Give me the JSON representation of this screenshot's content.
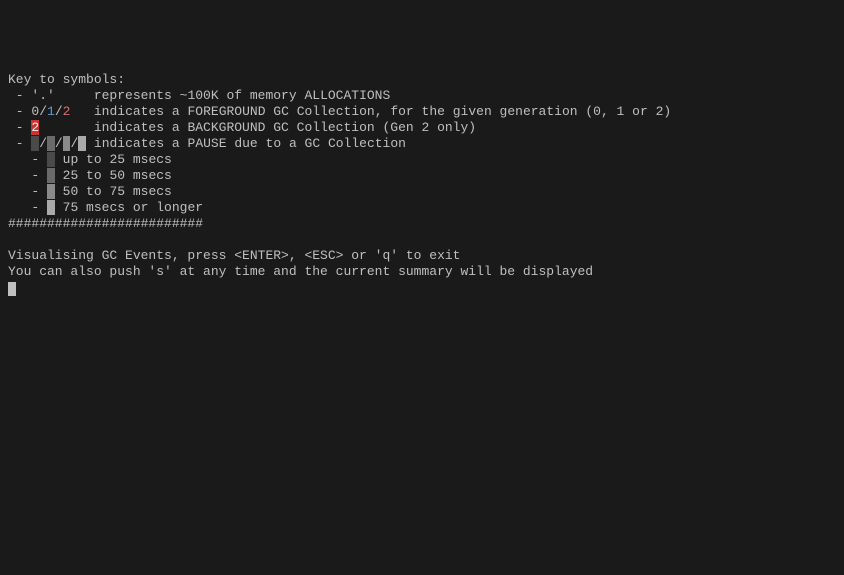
{
  "header": "Key to symbols:",
  "legend": {
    "dot_symbol": "'.'",
    "dot_desc": "represents ~100K of memory ALLOCATIONS",
    "gen_labels": {
      "g0": "0",
      "g1": "1",
      "g2": "2"
    },
    "gen_desc": "indicates a FOREGROUND GC Collection, for the given generation (0, 1 or 2)",
    "bg_symbol": "2",
    "bg_desc": "indicates a BACKGROUND GC Collection (Gen 2 only)",
    "pause_desc": "indicates a PAUSE due to a GC Collection",
    "pause_ranges": [
      "up to 25 msecs",
      "25 to 50 msecs",
      "50 to 75 msecs",
      "75 msecs or longer"
    ]
  },
  "divider": "#########################",
  "status": {
    "line1": "Visualising GC Events, press <ENTER>, <ESC> or 'q' to exit",
    "line2": "You can also push 's' at any time and the current summary will be displayed"
  }
}
